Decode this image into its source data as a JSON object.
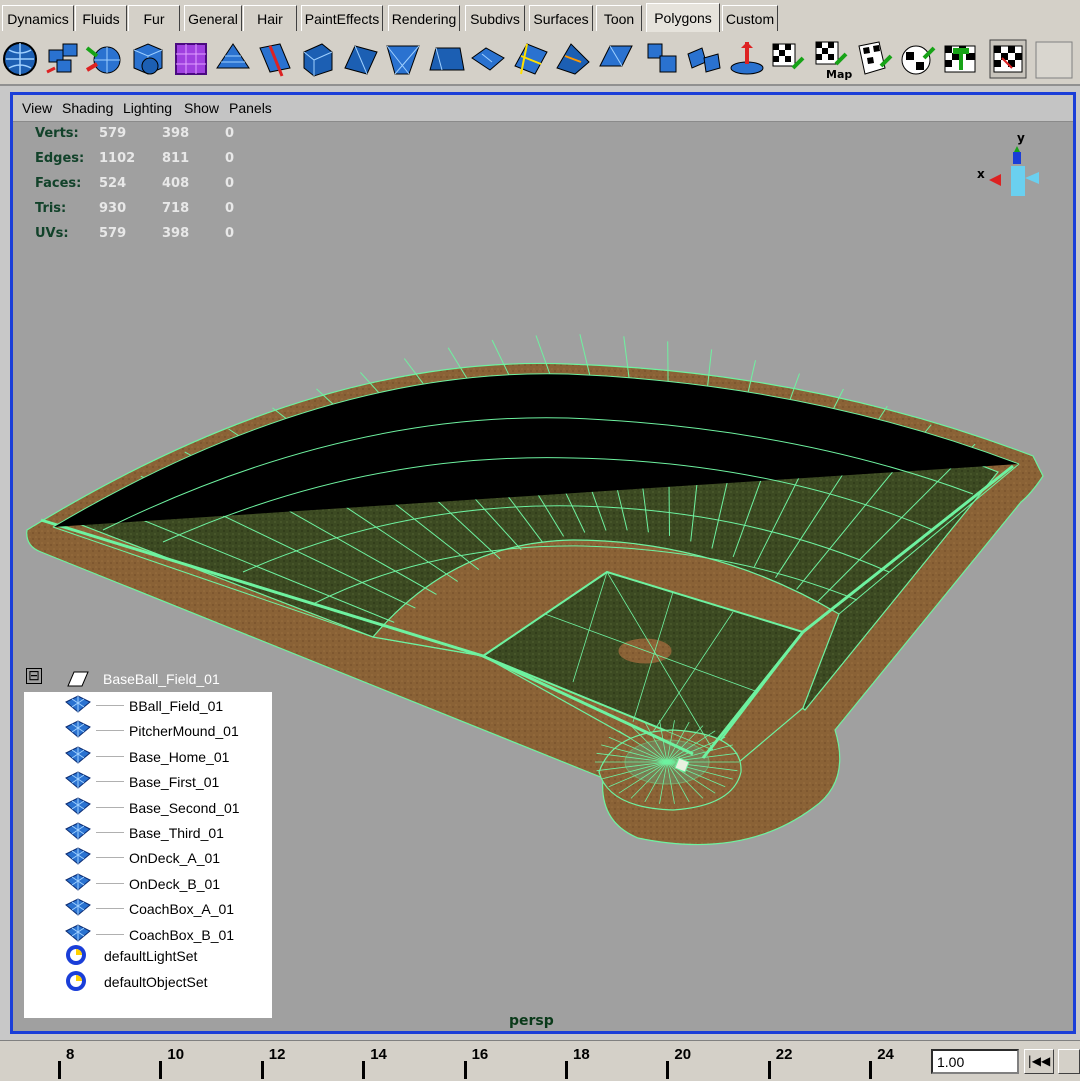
{
  "shelf_tabs": [
    {
      "label": "Dynamics"
    },
    {
      "label": "Fluids"
    },
    {
      "label": "Fur"
    },
    {
      "label": "General"
    },
    {
      "label": "Hair"
    },
    {
      "label": "PaintEffects"
    },
    {
      "label": "Rendering"
    },
    {
      "label": "Subdivs"
    },
    {
      "label": "Surfaces"
    },
    {
      "label": "Toon"
    },
    {
      "label": "Polygons"
    },
    {
      "label": "Custom"
    }
  ],
  "active_shelf": "Polygons",
  "shelf_icons": [
    "sphere-icon",
    "cube-icon",
    "cylinder-icon",
    "cube-icon",
    "plane-icon",
    "torus-icon",
    "extrude-icon",
    "split-icon",
    "bevel-icon",
    "wedge-icon",
    "append-icon",
    "bridge-icon",
    "merge-icon",
    "smooth-icon",
    "mirror-icon",
    "combine-icon",
    "separate-icon",
    "poke-icon",
    "uv-icon",
    "uv-map-icon",
    "uv-unfold-icon",
    "uv-layout-icon",
    "uv-editor-icon",
    "checker-icon",
    "empty-slot-icon"
  ],
  "viewport_menu": [
    "View",
    "Shading",
    "Lighting",
    "Show",
    "Panels"
  ],
  "hud": {
    "rows": [
      {
        "label": "Verts:",
        "values": [
          "579",
          "398",
          "0"
        ]
      },
      {
        "label": "Edges:",
        "values": [
          "1102",
          "811",
          "0"
        ]
      },
      {
        "label": "Faces:",
        "values": [
          "524",
          "408",
          "0"
        ]
      },
      {
        "label": "Tris:",
        "values": [
          "930",
          "718",
          "0"
        ]
      },
      {
        "label": "UVs:",
        "values": [
          "579",
          "398",
          "0"
        ]
      }
    ],
    "axis_x": "x",
    "axis_y": "y",
    "camera_label": "persp"
  },
  "outliner": {
    "collapse_glyph": "⊟",
    "root": "BaseBall_Field_01",
    "children": [
      "BBall_Field_01",
      "PitcherMound_01",
      "Base_Home_01",
      "Base_First_01",
      "Base_Second_01",
      "Base_Third_01",
      "OnDeck_A_01",
      "OnDeck_B_01",
      "CoachBox_A_01",
      "CoachBox_B_01"
    ],
    "sets": [
      "defaultLightSet",
      "defaultObjectSet"
    ]
  },
  "timeline": {
    "ticks": [
      "8",
      "10",
      "12",
      "14",
      "16",
      "18",
      "20",
      "22",
      "24"
    ],
    "current_time": "1.00",
    "rewind_glyph": "|◀◀"
  },
  "colors": {
    "grass": "#3c4a22",
    "dirt": "#8a6236",
    "wire": "#6ef2a0",
    "viewport_bg": "#a0a0a0",
    "panel_border": "#1a3ed8"
  }
}
